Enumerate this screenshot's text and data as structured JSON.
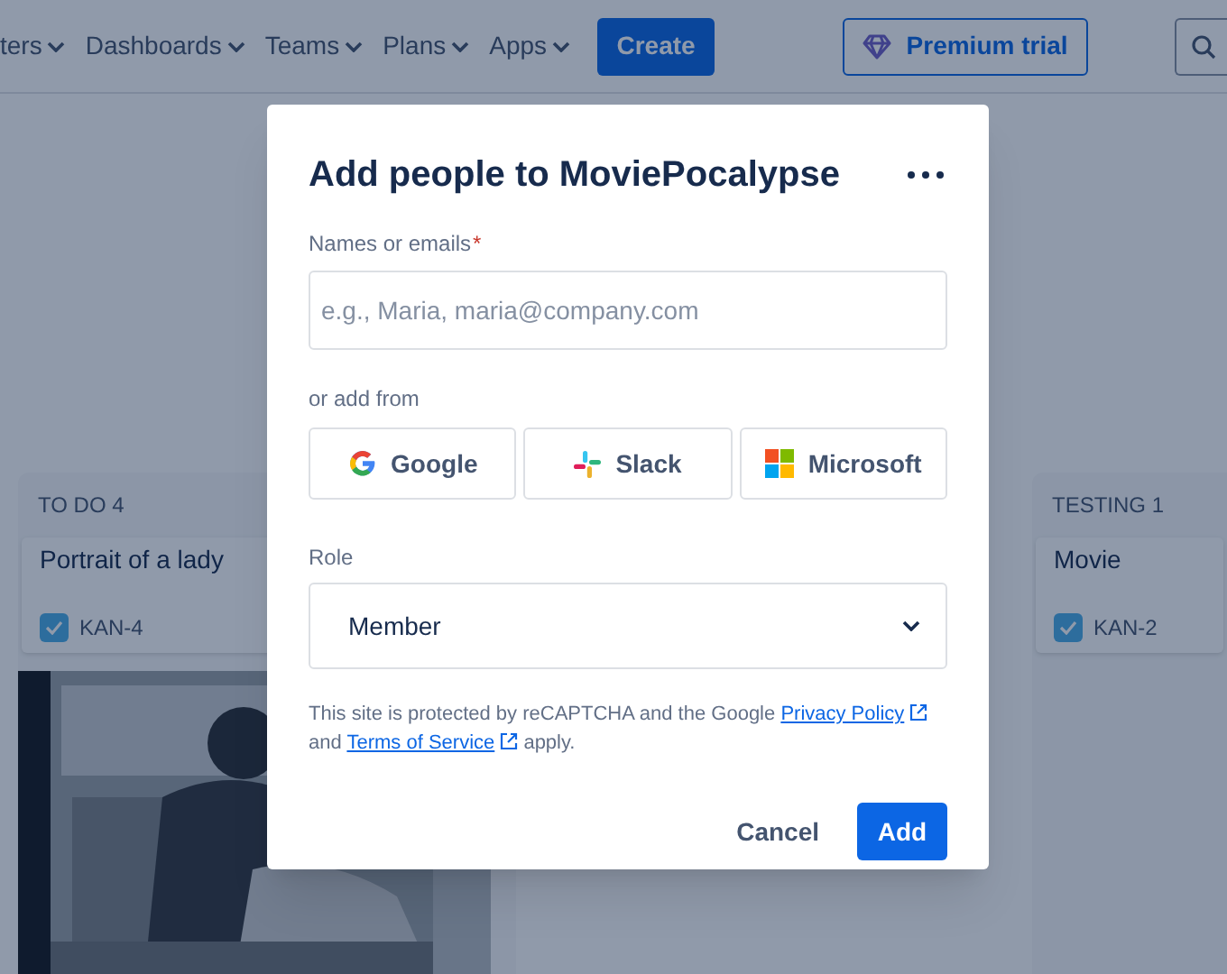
{
  "nav": {
    "items": [
      {
        "label": "ters"
      },
      {
        "label": "Dashboards"
      },
      {
        "label": "Teams"
      },
      {
        "label": "Plans"
      },
      {
        "label": "Apps"
      }
    ],
    "create": "Create",
    "premium": "Premium trial"
  },
  "board": {
    "columns": [
      {
        "title": "TO DO 4",
        "cards": [
          {
            "kind": "issue",
            "title": "Portrait of a lady",
            "key": "KAN-4",
            "checked": true
          },
          {
            "kind": "picture"
          }
        ]
      },
      {
        "title": "TESTING 1",
        "cards": [
          {
            "kind": "issue",
            "title": "Movie",
            "key": "KAN-2",
            "checked": true
          }
        ]
      }
    ]
  },
  "dialog": {
    "title": "Add people to MoviePocalypse",
    "names_label": "Names or emails",
    "required_mark": "*",
    "placeholder": "e.g., Maria, maria@company.com",
    "or_add_from": "or add from",
    "providers": [
      {
        "kind": "google",
        "label": "Google"
      },
      {
        "kind": "slack",
        "label": "Slack"
      },
      {
        "kind": "microsoft",
        "label": "Microsoft"
      }
    ],
    "role_label": "Role",
    "role": "Member",
    "notice": [
      {
        "kind": "text",
        "text": "This site is protected by reCAPTCHA and the Google "
      },
      {
        "kind": "link",
        "text": "Privacy Policy"
      },
      {
        "kind": "text",
        "text": " and "
      },
      {
        "kind": "link",
        "text": "Terms of Service"
      },
      {
        "kind": "text",
        "text": " apply."
      }
    ],
    "cancel": "Cancel",
    "add": "Add"
  }
}
